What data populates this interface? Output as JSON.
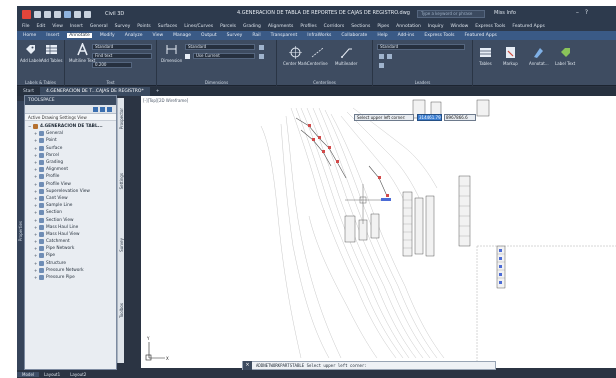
{
  "window": {
    "file_tab": "Civil 3D",
    "title": "4.GENERACION DE TABLA DE REPORTES DE CAJAS DE REGISTRO.dwg",
    "search_placeholder": "Type a keyword or phrase",
    "user": "Miss Info"
  },
  "menu": [
    "File",
    "Edit",
    "View",
    "Insert",
    "General",
    "Survey",
    "Points",
    "Surfaces",
    "Lines/Curves",
    "Parcels",
    "Grading",
    "Alignments",
    "Profiles",
    "Corridors",
    "Sections",
    "Pipes",
    "Annotation",
    "Inquiry",
    "Window",
    "Express Tools",
    "Featured Apps"
  ],
  "tabs": [
    {
      "label": "Home"
    },
    {
      "label": "Insert"
    },
    {
      "label": "Annotate",
      "active": true
    },
    {
      "label": "Modify"
    },
    {
      "label": "Analyze"
    },
    {
      "label": "View"
    },
    {
      "label": "Manage"
    },
    {
      "label": "Output"
    },
    {
      "label": "Survey"
    },
    {
      "label": "Rail"
    },
    {
      "label": "Transparent"
    },
    {
      "label": "InfraWorks"
    },
    {
      "label": "Collaborate"
    },
    {
      "label": "Help"
    },
    {
      "label": "Add-ins"
    },
    {
      "label": "Express Tools"
    },
    {
      "label": "Featured Apps"
    }
  ],
  "ribbon": {
    "add_labels": "Add Labels",
    "add_tables": "Add Tables",
    "multiline_text": "Multiline Text",
    "text_style": "Standard",
    "find_text": "Find text",
    "text_height": "0.200",
    "text_panel": "Text",
    "dimension": "Dimension",
    "dim_style": "Standard",
    "layer_current": "Use Current",
    "dimensions_panel": "Dimensions",
    "center_mark": "Center Mark",
    "centerline": "Centerline",
    "centerlines_panel": "Centerlines",
    "multileader": "Multileader",
    "leader_style": "Standard",
    "leaders_panel": "Leaders",
    "table": "Tables",
    "markup": "Markup",
    "annotate": "Annotat...",
    "label_text": "Label Text",
    "labels_tables_panel": "Labels & Tables"
  },
  "doc_tabs": [
    "Start",
    "4.GENERACION DE T...CAJAS DE REGISTRO*"
  ],
  "toolspace": {
    "title": "TOOLSPACE",
    "view": "Active Drawing Settings View",
    "root": "4.GENERACION DE TABL...",
    "items": [
      "General",
      "Point",
      "Surface",
      "Parcel",
      "Grading",
      "Alignment",
      "Profile",
      "Profile View",
      "Superelevation View",
      "Cant View",
      "Sample Line",
      "Section",
      "Section View",
      "Mass Haul Line",
      "Mass Haul View",
      "Catchment",
      "Pipe Network",
      "Pipe",
      "Structure",
      "Pressure Network",
      "Pressure Pipe"
    ]
  },
  "side_tabs": [
    "Prospector",
    "Settings",
    "Survey",
    "Toolbox"
  ],
  "left_strip_label": "Properties",
  "drawing": {
    "view_label": "[-][Top][2D Wireframe]",
    "prompt": "Select upper left corner:",
    "coord_x": "314461.79",
    "coord_y": "8967866.6"
  },
  "command": {
    "text": "ADDNETWORKPARTSTABLE Select upper left corner:"
  },
  "status_tabs": [
    {
      "label": "Model",
      "active": true
    },
    {
      "label": "Layout1"
    },
    {
      "label": "Layout2"
    }
  ],
  "colors": {
    "accent": "#3d7fd1",
    "dark": "#2b3443",
    "ribbon": "#3e4c61"
  }
}
